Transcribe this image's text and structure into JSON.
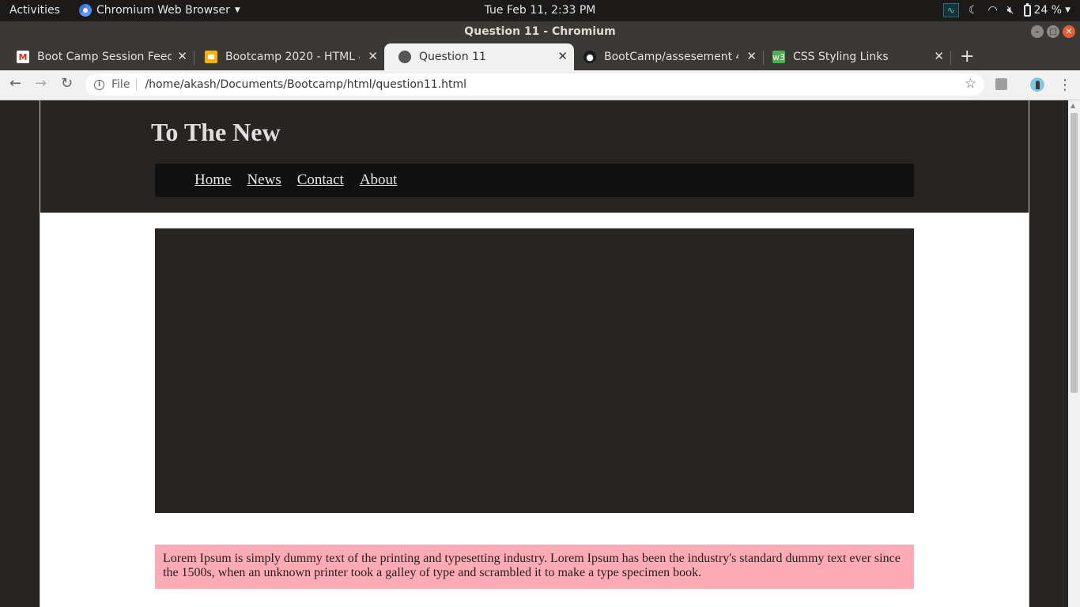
{
  "system": {
    "activities": "Activities",
    "app_name": "Chromium Web Browser",
    "clock": "Tue Feb 11,  2:33 PM",
    "battery": "24 %",
    "tray_icons": [
      "system-monitor-icon",
      "night-light-icon",
      "wifi-icon",
      "volume-muted-icon",
      "battery-icon"
    ]
  },
  "window": {
    "title": "Question 11 - Chromium"
  },
  "tabs": [
    {
      "label": "Boot Camp Session Feedb",
      "icon": "gmail-icon",
      "active": false
    },
    {
      "label": "Bootcamp 2020 - HTML & ",
      "icon": "google-slides-icon",
      "active": false
    },
    {
      "label": "Question 11",
      "icon": "globe-icon",
      "active": true
    },
    {
      "label": "BootCamp/assesement 4",
      "icon": "github-icon",
      "active": false
    },
    {
      "label": "CSS Styling Links",
      "icon": "w3schools-icon",
      "active": false
    }
  ],
  "toolbar": {
    "scheme": "File",
    "url": "/home/akash/Documents/Bootcamp/html/question11.html"
  },
  "page": {
    "site_title": "To The New",
    "nav": [
      "Home",
      "News",
      "Contact",
      "About"
    ],
    "lorem": "Lorem Ipsum is simply dummy text of the printing and typesetting industry. Lorem Ipsum has been the industry's standard dummy text ever since the 1500s, when an unknown printer took a galley of type and scrambled it to make a type specimen book."
  },
  "colors": {
    "header_bg": "#282422",
    "nav_bg": "#121111",
    "hero_bg": "#282422",
    "lorem_bg": "#ffabb6"
  }
}
